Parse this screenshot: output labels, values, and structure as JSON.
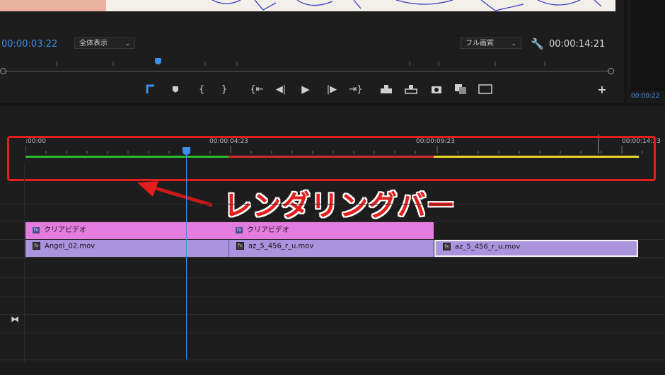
{
  "monitor": {
    "current_timecode": "00:00:03:22",
    "zoom_label": "全体表示",
    "quality_label": "フル画質",
    "duration_timecode": "00:00:14:21",
    "side_timecode": "00:00:22"
  },
  "controls": {
    "icons": [
      "mark-in-icon",
      "add-marker-icon",
      "mark-in-brace-icon",
      "mark-out-brace-icon",
      "go-to-in-icon",
      "step-back-icon",
      "play-icon",
      "step-forward-icon",
      "go-to-out-icon",
      "insert-icon",
      "overwrite-icon",
      "export-frame-icon",
      "comparison-view-icon",
      "safe-margins-icon",
      "add-button-icon"
    ]
  },
  "timeline": {
    "ruler_labels": [
      ":00:00",
      "00:00:04:23",
      "00:00:09:23",
      "00:00:14:23"
    ],
    "playhead_fraction": 0.26,
    "render_bar": [
      {
        "status": "green",
        "color": "#2dbb2d"
      },
      {
        "status": "red",
        "color": "#d42a2a"
      },
      {
        "status": "yellow",
        "color": "#e5d62a"
      }
    ]
  },
  "annotation": {
    "label": "レンダリングバー",
    "highlight_color": "#e41d1d"
  },
  "tracks": {
    "effect_clips": [
      {
        "label": "クリアビデオ",
        "fx": "fx"
      },
      {
        "label": "クリアビデオ",
        "fx": "fx"
      }
    ],
    "video_clips": [
      {
        "label": "Angel_02.mov"
      },
      {
        "label": "az_5_456_r_u.mov"
      },
      {
        "label": "az_5_456_r_u.mov"
      }
    ],
    "track_toggle_icon": "bowtie-icon"
  }
}
